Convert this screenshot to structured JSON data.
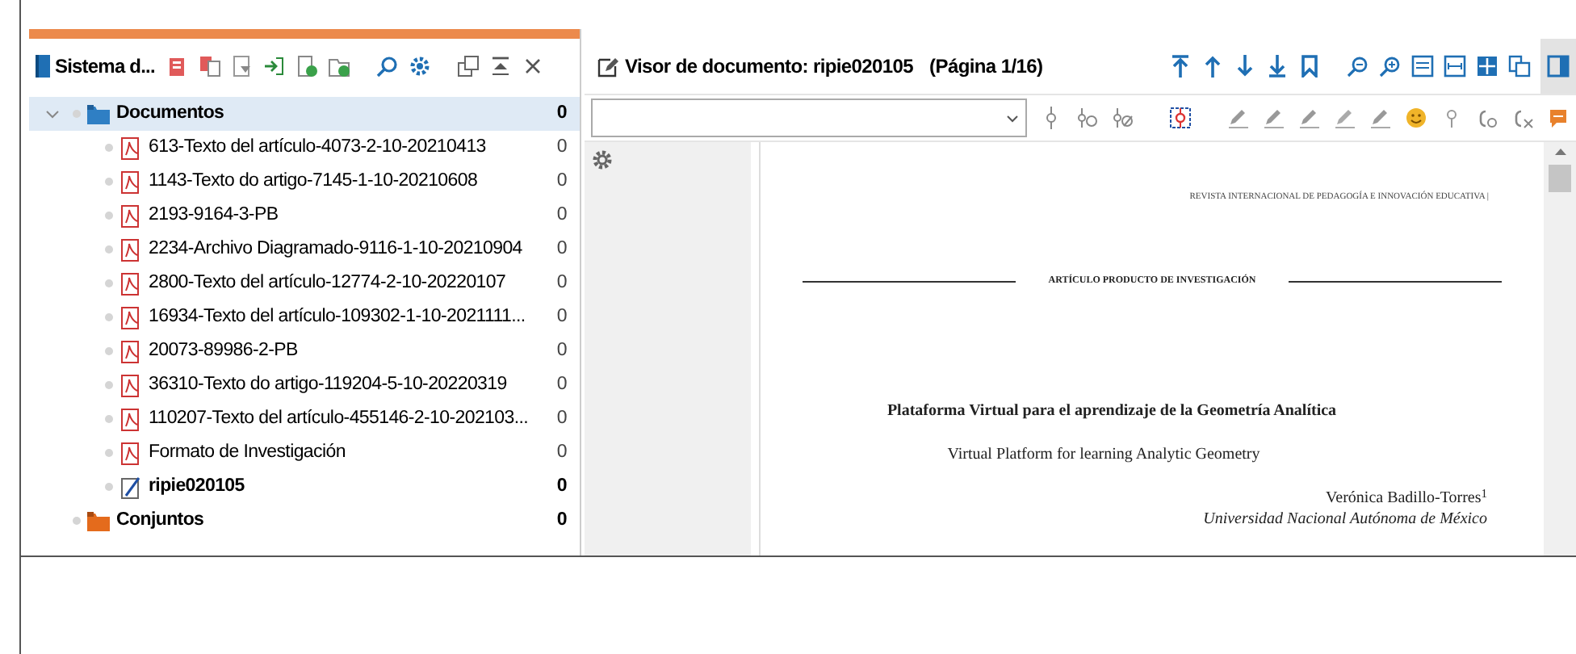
{
  "left_panel": {
    "title": "Sistema d...",
    "tree": [
      {
        "label": "Documentos",
        "kind": "folder",
        "count": "0",
        "expanded": true,
        "selected": true,
        "children": [
          {
            "label": "613-Texto del artículo-4073-2-10-20210413",
            "kind": "pdf",
            "count": "0",
            "active": false
          },
          {
            "label": "1143-Texto do artigo-7145-1-10-20210608",
            "kind": "pdf",
            "count": "0",
            "active": false
          },
          {
            "label": "2193-9164-3-PB",
            "kind": "pdf",
            "count": "0",
            "active": false
          },
          {
            "label": "2234-Archivo Diagramado-9116-1-10-20210904",
            "kind": "pdf",
            "count": "0",
            "active": false
          },
          {
            "label": "2800-Texto del artículo-12774-2-10-20220107",
            "kind": "pdf",
            "count": "0",
            "active": false
          },
          {
            "label": "16934-Texto del artículo-109302-1-10-2021111...",
            "kind": "pdf",
            "count": "0",
            "active": false
          },
          {
            "label": "20073-89986-2-PB",
            "kind": "pdf",
            "count": "0",
            "active": false
          },
          {
            "label": "36310-Texto do artigo-119204-5-10-20220319",
            "kind": "pdf",
            "count": "0",
            "active": false
          },
          {
            "label": "110207-Texto del artículo-455146-2-10-202103...",
            "kind": "pdf",
            "count": "0",
            "active": false
          },
          {
            "label": "Formato de Investigación",
            "kind": "pdf",
            "count": "0",
            "active": false
          },
          {
            "label": "ripie020105",
            "kind": "note",
            "count": "0",
            "active": true
          }
        ]
      },
      {
        "label": "Conjuntos",
        "kind": "set",
        "count": "0",
        "expanded": false,
        "selected": false
      }
    ]
  },
  "viewer": {
    "title": "Visor de documento: ripie020105",
    "page": "(Página 1/16)",
    "page_content": {
      "running_head": "REVISTA INTERNACIONAL DE PEDAGOGÍA E INNOVACIÓN EDUCATIVA |",
      "section": "ARTÍCULO PRODUCTO DE INVESTIGACIÓN",
      "title": "Plataforma Virtual para el aprendizaje de la Geometría Analítica",
      "subtitle": "Virtual Platform for learning Analytic Geometry",
      "author": "Verónica Badillo-Torres$^{1}$",
      "affiliation": "Universidad Nacional Autónoma de México"
    }
  }
}
